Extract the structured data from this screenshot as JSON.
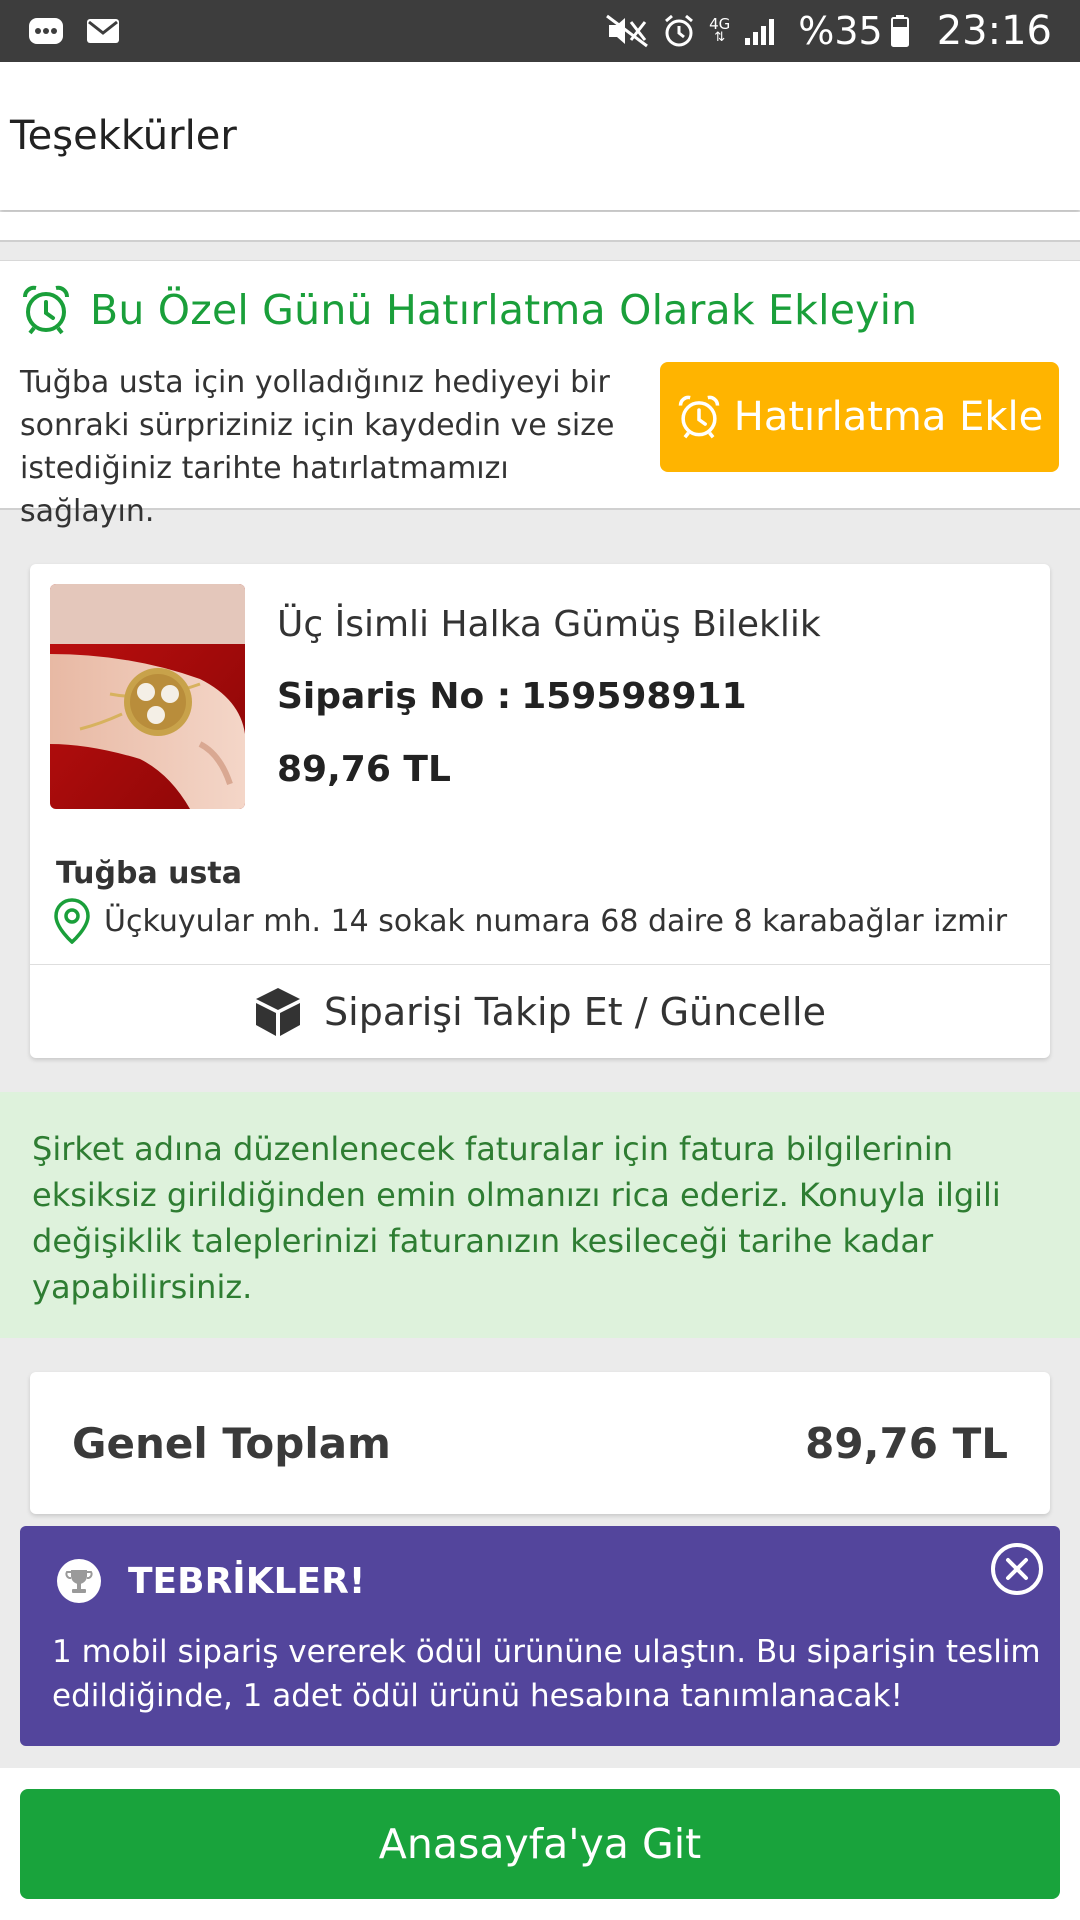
{
  "status_bar": {
    "battery_text": "%35",
    "time": "23:16",
    "network": "4G",
    "icons": [
      "chat-icon",
      "mail-icon",
      "mute-icon",
      "alarm-icon",
      "network-4g-icon",
      "signal-icon",
      "battery-icon"
    ]
  },
  "header": {
    "title": "Teşekkürler"
  },
  "reminder": {
    "title": "Bu Özel Günü Hatırlatma Olarak Ekleyin",
    "description": "Tuğba usta için yolladığınız hediyeyi bir sonraki sürpriziniz için kaydedin ve size istediğiniz tarihte hatırlatmamızı sağlayın.",
    "button_label": "Hatırlatma Ekle",
    "accent_color": "#1a9f3a",
    "button_color": "#ffb400"
  },
  "order": {
    "product_name": "Üç İsimli Halka Gümüş Bileklik",
    "order_no_label": "Sipariş No :",
    "order_no": "159598911",
    "price": "89,76 TL",
    "recipient": "Tuğba usta",
    "address": "Üçkuyular mh. 14 sokak numara 68 daire 8 karabağlar izmir",
    "track_label": "Siparişi Takip Et / Güncelle"
  },
  "invoice_note": "Şirket adına düzenlenecek faturalar için fatura bilgilerinin eksiksiz girildiğinden emin olmanızı rica ederiz. Konuyla ilgili değişiklik taleplerinizi faturanızın kesileceği tarihe kadar yapabilirsiniz.",
  "total": {
    "label": "Genel Toplam",
    "value": "89,76 TL"
  },
  "congrats": {
    "title": "TEBRİKLER!",
    "message": "1 mobil sipariş vererek ödül ürününe ulaştın. Bu siparişin teslim edildiğinde, 1 adet ödül ürünü hesabına tanımlanacak!",
    "background": "#53459c"
  },
  "home_button": {
    "label": "Anasayfa'ya Git",
    "color": "#19a33c"
  }
}
